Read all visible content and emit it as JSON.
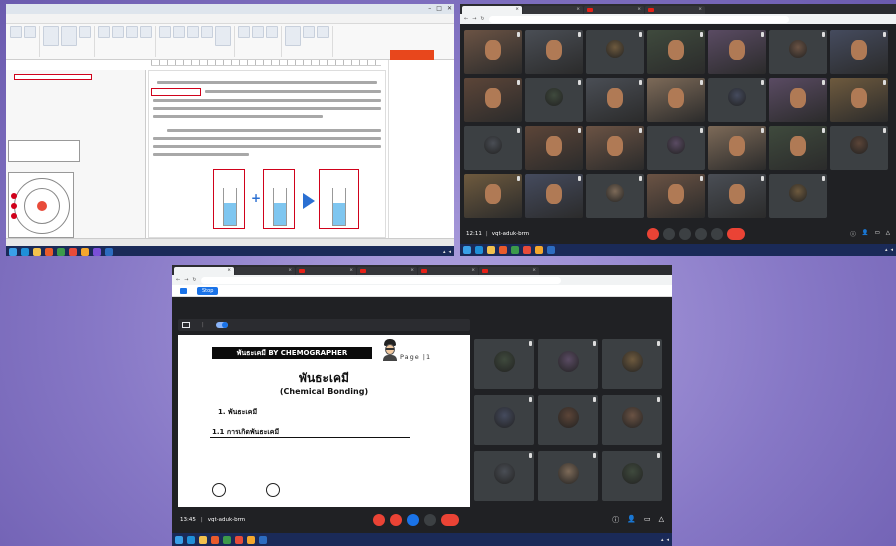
{
  "panel_editor": {
    "window_title": "",
    "ribbon_tabs": [
      "",
      "",
      "",
      "",
      "",
      "",
      "",
      "",
      "",
      ""
    ],
    "active_tab_index": 1,
    "ribbon_groups": [
      "",
      "",
      "",
      "",
      "",
      ""
    ],
    "side_text": "",
    "thumbnail_label": "",
    "page_heading": "",
    "highlighted_term": "",
    "notes_header": "",
    "status_items": [
      "",
      "",
      ""
    ],
    "figure_labels": [
      "",
      "",
      ""
    ]
  },
  "panel_meet_grid": {
    "browser_tabs": [
      "",
      "",
      "",
      ""
    ],
    "address": "",
    "participants": [
      "",
      "",
      "",
      "",
      "",
      "",
      "",
      "",
      "",
      "",
      "",
      "",
      "",
      "",
      "",
      "",
      "",
      "",
      "",
      "",
      "",
      "",
      "",
      "",
      "",
      "",
      ""
    ],
    "time": "12:11",
    "meeting_code": "vqt-aduk-brm",
    "colors": {
      "end_call": "#ea4335",
      "tile": "#3c4043",
      "bar": "#202124"
    }
  },
  "panel_meet_present": {
    "browser_tabs": [
      "",
      "",
      "",
      "",
      "",
      ""
    ],
    "address": "",
    "share_notice": "",
    "stop_label": "Stop",
    "show_label": "",
    "presenting_text": "",
    "presenting_user": "",
    "slide": {
      "header": "พันธะเคมี BY CHEMOGRAPHER",
      "page_label": "Page |1",
      "title_th": "พันธะเคมี",
      "title_en": "(Chemical Bonding)",
      "section_1": "1. พันธะเคมี",
      "section_11": "1.1 การเกิดพันธะเคมี",
      "paragraph_1": "",
      "paragraph_2": "",
      "paragraph_3": "",
      "option_text": ""
    },
    "participants": [
      "",
      "",
      "",
      "",
      "",
      "",
      "",
      "",
      "",
      "",
      "",
      ""
    ],
    "time": "13:45",
    "meeting_code": "vqt-aduk-brm",
    "colors": {
      "end_call": "#ea4335",
      "accent": "#1a73e8"
    }
  }
}
